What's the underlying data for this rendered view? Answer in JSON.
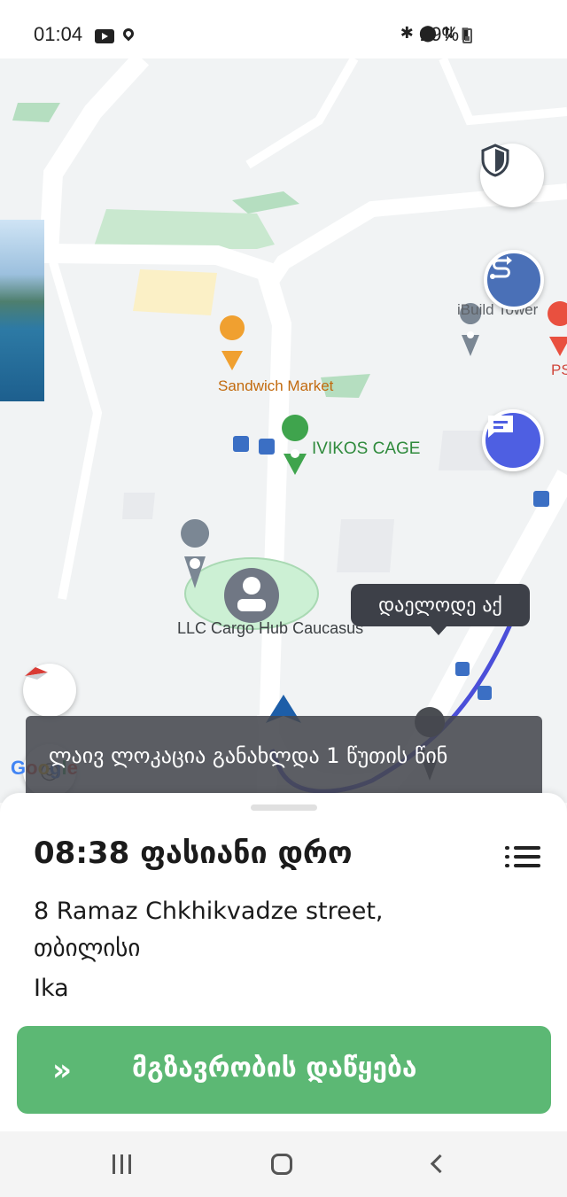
{
  "status_bar": {
    "time": "01:04",
    "icons_left": [
      "youtube-icon",
      "location-icon"
    ],
    "icons_right": [
      "bluetooth-icon",
      "location-icon",
      "data-transfer-icon",
      "signal-icon"
    ],
    "battery": "29%"
  },
  "map": {
    "labels": {
      "ibuild": "iBuild Tower",
      "ps": "PS",
      "sandwich": "Sandwich Market",
      "ivikos": "IVIKOS CAGE",
      "cargo": "LLC Cargo Hub Caucasus"
    },
    "google": "Google",
    "wait_bubble": "დაელოდე აქ",
    "toast": "ლაივ ლოკაცია განახლდა 1 წუთის წინ",
    "colors": {
      "route": "#4b4fd9",
      "chat_button": "#4e5fe2",
      "route_button": "#4a70b7",
      "pickup_pin": "#4caf69"
    }
  },
  "sheet": {
    "eta": "08:38 ფასიანი დრო",
    "address": "8 Ramaz Chkhikvadze street, თბილისი",
    "passenger": "Ika",
    "start_button": "მგზავრობის დაწყება",
    "start_button_color": "#5cb874"
  }
}
